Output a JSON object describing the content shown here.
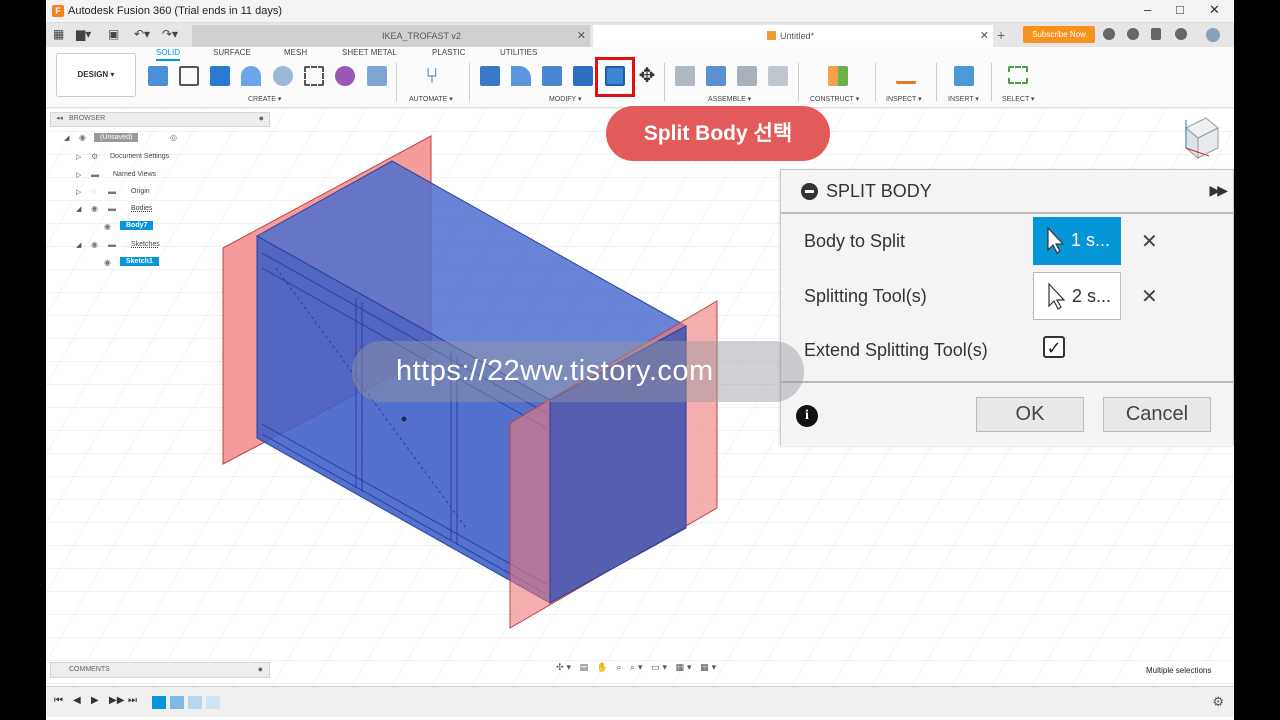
{
  "window": {
    "title": "Autodesk Fusion 360 (Trial ends in 11 days)"
  },
  "tabs": [
    {
      "label": "IKEA_TROFAST v2",
      "active": false
    },
    {
      "label": "Untitled*",
      "active": true
    }
  ],
  "header": {
    "subscribe_label": "Subscribe Now"
  },
  "toolbar": {
    "design_label": "DESIGN ▾",
    "tabs": [
      "SOLID",
      "SURFACE",
      "MESH",
      "SHEET METAL",
      "PLASTIC",
      "UTILITIES"
    ],
    "groups": [
      "CREATE ▾",
      "AUTOMATE ▾",
      "MODIFY ▾",
      "ASSEMBLE ▾",
      "CONSTRUCT ▾",
      "INSPECT ▾",
      "INSERT ▾",
      "SELECT ▾"
    ]
  },
  "callout": {
    "text": "Split Body 선택"
  },
  "browser": {
    "title": "BROWSER",
    "items": [
      "(Unsaved)",
      "Document Settings",
      "Named Views",
      "Origin",
      "Bodies",
      "Body7",
      "Sketches",
      "Sketch1"
    ]
  },
  "comments": {
    "title": "COMMENTS"
  },
  "status": {
    "text": "Multiple selections"
  },
  "watermark": {
    "text": "https://22ww.tistory.com"
  },
  "dialog": {
    "title": "SPLIT BODY",
    "body_to_split_label": "Body to Split",
    "body_to_split_value": "1 s...",
    "splitting_tools_label": "Splitting Tool(s)",
    "splitting_tools_value": "2 s...",
    "extend_label": "Extend Splitting Tool(s)",
    "extend_checked": true,
    "ok_label": "OK",
    "cancel_label": "Cancel"
  },
  "colors": {
    "accent": "#0696d7",
    "body": "#3e63c4",
    "plane": "#f07a7a",
    "callout": "#e35a5a",
    "highlight": "#e01010"
  }
}
